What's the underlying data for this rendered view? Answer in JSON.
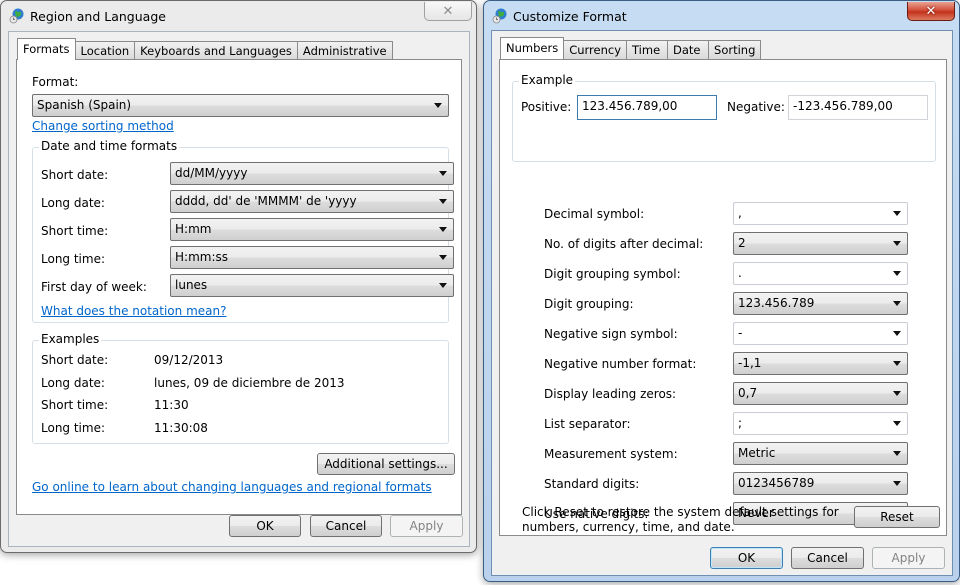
{
  "region_dialog": {
    "title": "Region and Language",
    "close_glyph": "✕",
    "tabs": [
      {
        "label": "Formats",
        "selected": true
      },
      {
        "label": "Location",
        "selected": false
      },
      {
        "label": "Keyboards and Languages",
        "selected": false
      },
      {
        "label": "Administrative",
        "selected": false
      }
    ],
    "format_label": "Format:",
    "format_value": "Spanish (Spain)",
    "change_sorting_link": "Change sorting method",
    "date_time_group_title": "Date and time formats",
    "date_time_fields": [
      {
        "label": "Short date:",
        "value": "dd/MM/yyyy"
      },
      {
        "label": "Long date:",
        "value": "dddd, dd' de 'MMMM' de 'yyyy"
      },
      {
        "label": "Short time:",
        "value": "H:mm"
      },
      {
        "label": "Long time:",
        "value": "H:mm:ss"
      },
      {
        "label": "First day of week:",
        "value": "lunes"
      }
    ],
    "notation_link": "What does the notation mean?",
    "examples_group_title": "Examples",
    "examples": [
      {
        "label": "Short date:",
        "value": "09/12/2013"
      },
      {
        "label": "Long date:",
        "value": "lunes, 09 de diciembre de 2013"
      },
      {
        "label": "Short time:",
        "value": "11:30"
      },
      {
        "label": "Long time:",
        "value": "11:30:08"
      }
    ],
    "additional_settings_button": "Additional settings...",
    "online_link": "Go online to learn about changing languages and regional formats",
    "ok_button": "OK",
    "cancel_button": "Cancel",
    "apply_button": "Apply"
  },
  "customize_dialog": {
    "title": "Customize Format",
    "close_glyph": "✕",
    "tabs": [
      {
        "label": "Numbers",
        "selected": true
      },
      {
        "label": "Currency",
        "selected": false
      },
      {
        "label": "Time",
        "selected": false
      },
      {
        "label": "Date",
        "selected": false
      },
      {
        "label": "Sorting",
        "selected": false
      }
    ],
    "example_group_title": "Example",
    "positive_label": "Positive:",
    "positive_value": "123.456.789,00",
    "negative_label": "Negative:",
    "negative_value": "-123.456.789,00",
    "fields": [
      {
        "label": "Decimal symbol:",
        "value": ",",
        "editable": true
      },
      {
        "label": "No. of digits after decimal:",
        "value": "2",
        "editable": false
      },
      {
        "label": "Digit grouping symbol:",
        "value": ".",
        "editable": true
      },
      {
        "label": "Digit grouping:",
        "value": "123.456.789",
        "editable": false
      },
      {
        "label": "Negative sign symbol:",
        "value": "-",
        "editable": true
      },
      {
        "label": "Negative number format:",
        "value": "-1,1",
        "editable": false
      },
      {
        "label": "Display leading zeros:",
        "value": "0,7",
        "editable": false
      },
      {
        "label": "List separator:",
        "value": ";",
        "editable": true
      },
      {
        "label": "Measurement system:",
        "value": "Metric",
        "editable": false
      },
      {
        "label": "Standard digits:",
        "value": "0123456789",
        "editable": false
      },
      {
        "label": "Use native digits:",
        "value": "Never",
        "editable": false
      }
    ],
    "reset_note_line1": "Click Reset to restore the system default settings for",
    "reset_note_line2": "numbers, currency, time, and date.",
    "reset_button": "Reset",
    "ok_button": "OK",
    "cancel_button": "Cancel",
    "apply_button": "Apply"
  }
}
